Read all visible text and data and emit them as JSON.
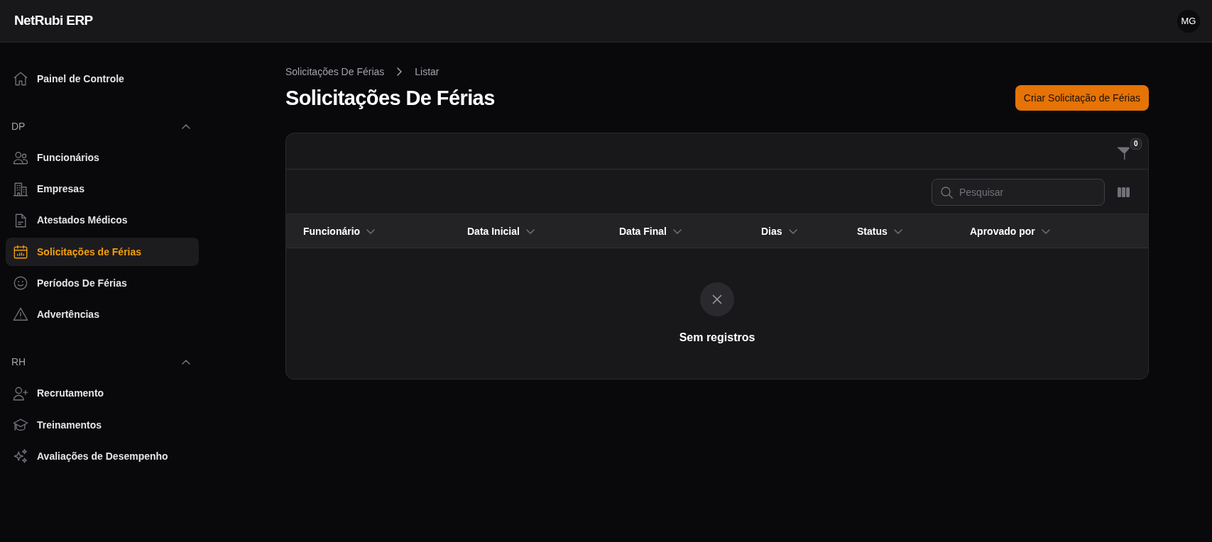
{
  "topbar": {
    "brand": "NetRubi ERP",
    "avatar": "MG"
  },
  "sidebar": {
    "items": [
      {
        "label": "Painel de Controle",
        "selected": false
      }
    ],
    "groups": [
      {
        "label": "DP",
        "expanded": true,
        "items": [
          {
            "label": "Funcionários",
            "selected": false
          },
          {
            "label": "Empresas",
            "selected": false
          },
          {
            "label": "Atestados Médicos",
            "selected": false
          },
          {
            "label": "Solicitações de Férias",
            "selected": true
          },
          {
            "label": "Períodos De Férias",
            "selected": false
          },
          {
            "label": "Advertências",
            "selected": false
          }
        ]
      },
      {
        "label": "RH",
        "expanded": true,
        "items": [
          {
            "label": "Recrutamento",
            "selected": false
          },
          {
            "label": "Treinamentos",
            "selected": false
          },
          {
            "label": "Avaliações de Desempenho",
            "selected": false
          }
        ]
      }
    ]
  },
  "breadcrumb": [
    "Solicitações De Férias",
    "Listar"
  ],
  "page_title": "Solicitações De Férias",
  "create_button": "Criar Solicitação de Férias",
  "table": {
    "filter_count": "0",
    "search": {
      "placeholder": "Pesquisar"
    },
    "columns": [
      "Funcionário",
      "Data Inicial",
      "Data Final",
      "Dias",
      "Status",
      "Aprovado por"
    ],
    "empty_message": "Sem registros"
  }
}
